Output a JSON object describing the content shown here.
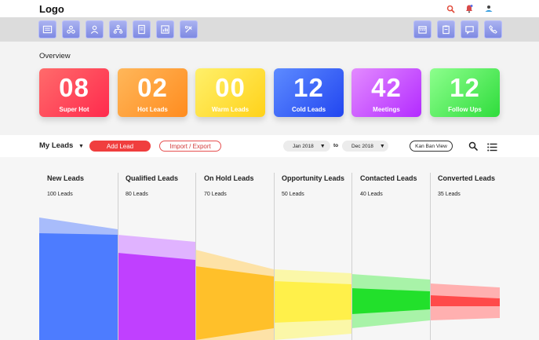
{
  "header": {
    "logo": "Logo"
  },
  "top_icons": [
    "search-icon",
    "notification-icon",
    "user-icon"
  ],
  "toolbar": {
    "left_icons": [
      "dashboard-icon",
      "network-icon",
      "user-icon",
      "org-chart-icon",
      "document-icon",
      "report-icon",
      "tools-icon"
    ],
    "right_icons": [
      "calendar-icon",
      "clipboard-icon",
      "message-icon",
      "phone-icon"
    ]
  },
  "overview": {
    "title": "Overview",
    "cards": [
      {
        "value": "08",
        "label": "Super Hot",
        "color_from": "#ff6b6b",
        "color_to": "#ff2a4d"
      },
      {
        "value": "02",
        "label": "Hot Leads",
        "color_from": "#ffb75a",
        "color_to": "#ff8c1f"
      },
      {
        "value": "00",
        "label": "Warm Leads",
        "color_from": "#fff06a",
        "color_to": "#ffd21a"
      },
      {
        "value": "12",
        "label": "Cold Leads",
        "color_from": "#5d8bff",
        "color_to": "#2246f0"
      },
      {
        "value": "42",
        "label": "Meetings",
        "color_from": "#e38bff",
        "color_to": "#b32bff"
      },
      {
        "value": "12",
        "label": "Follow Ups",
        "color_from": "#8dff8d",
        "color_to": "#2fdc3c"
      }
    ]
  },
  "leads_bar": {
    "title": "My Leads",
    "add_lead": "Add Lead",
    "import_export": "Import / Export",
    "date_from": "Jan 2018",
    "to_label": "to",
    "date_to": "Dec 2018",
    "kanban_view": "Kan Ban View"
  },
  "funnel": {
    "stages": [
      {
        "title": "New Leads",
        "count": "100 Leads",
        "color": "#4d7cff",
        "light": "#a8bcfb"
      },
      {
        "title": "Qualified Leads",
        "count": "80 Leads",
        "color": "#c040ff",
        "light": "#e0b3ff"
      },
      {
        "title": "On Hold Leads",
        "count": "70 Leads",
        "color": "#ffc02a",
        "light": "#fde2a7"
      },
      {
        "title": "Opportunity Leads",
        "count": "50 Leads",
        "color": "#fff04a",
        "light": "#fbf7a8"
      },
      {
        "title": "Contacted Leads",
        "count": "40 Leads",
        "color": "#22e02b",
        "light": "#a8f3a8"
      },
      {
        "title": "Converted Leads",
        "count": "35 Leads",
        "color": "#ff4a4a",
        "light": "#ffb0b0"
      }
    ]
  }
}
